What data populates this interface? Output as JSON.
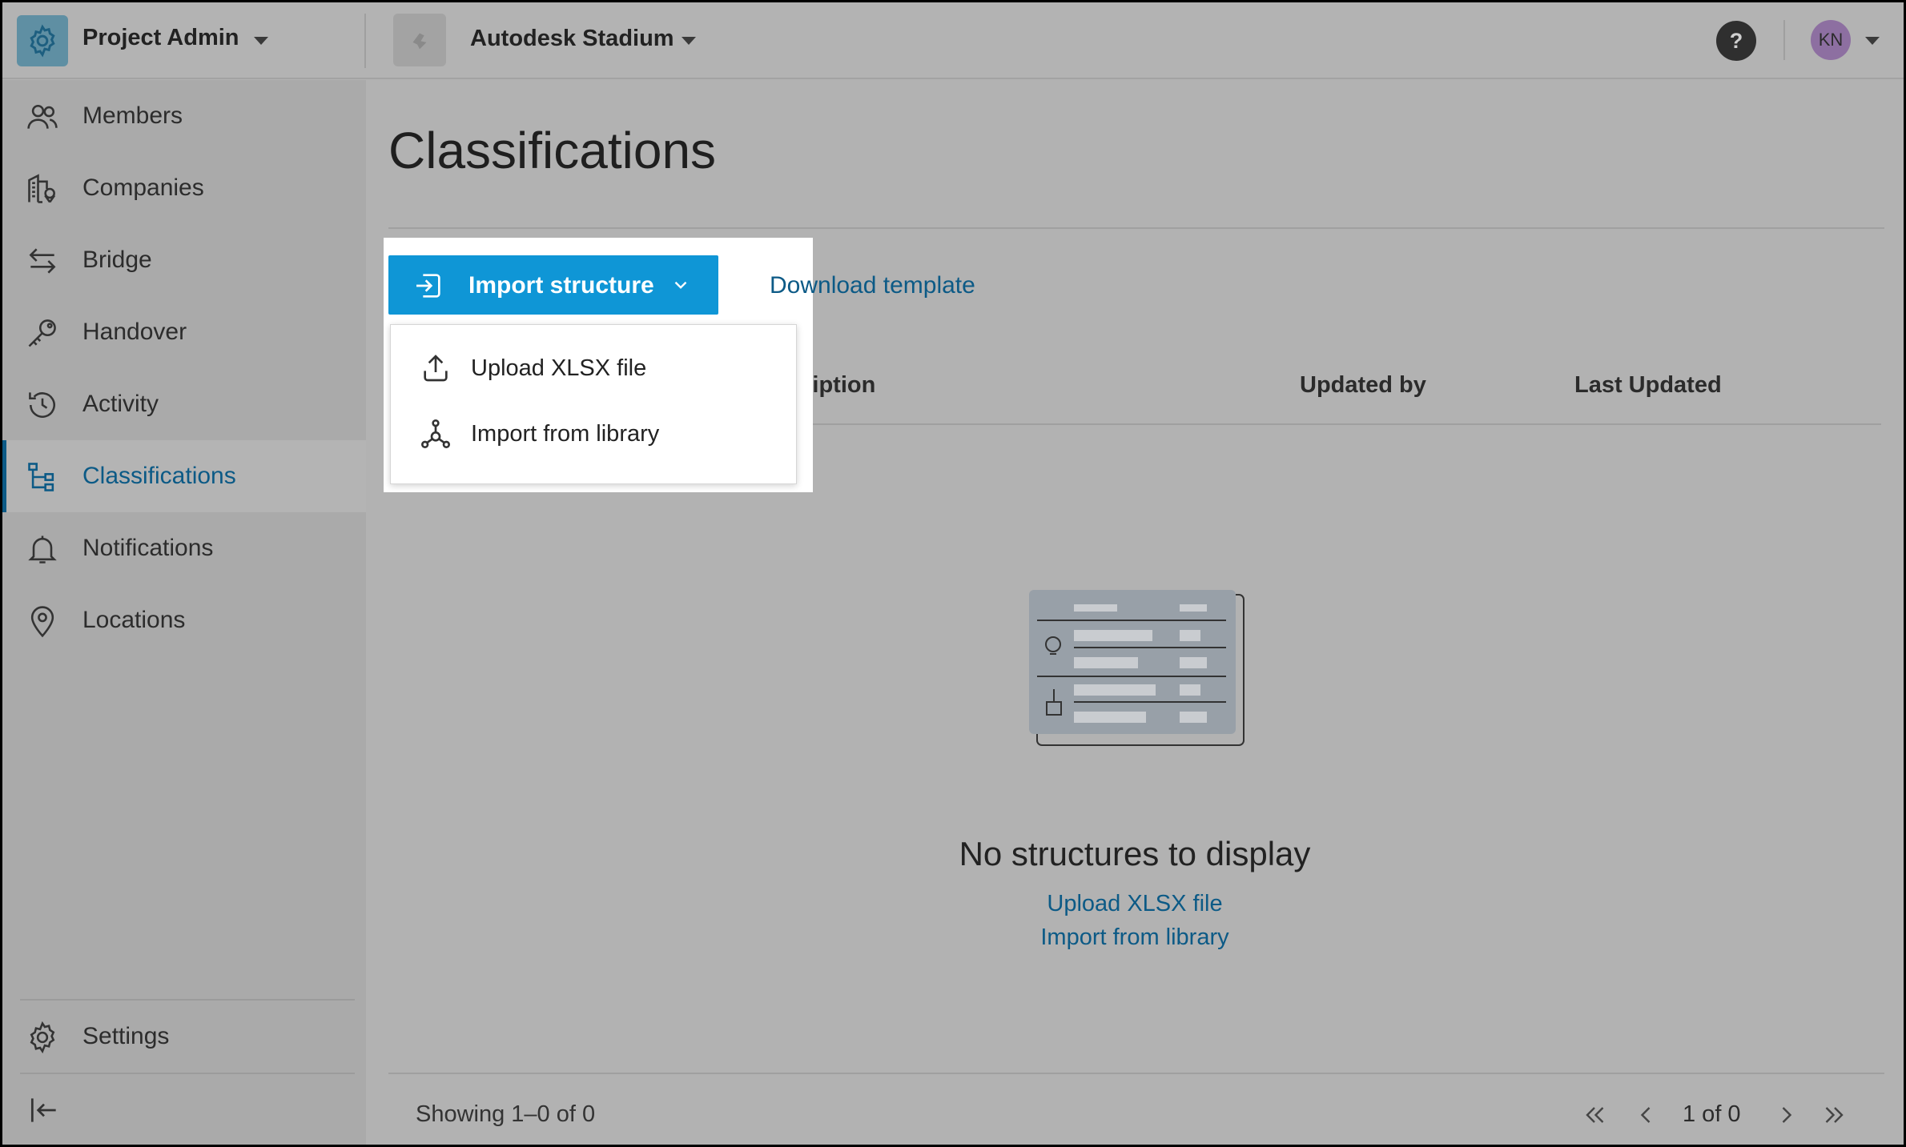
{
  "header": {
    "app_title": "Project Admin",
    "project_name": "Autodesk Stadium",
    "help_label": "?",
    "avatar_initials": "KN"
  },
  "sidebar": {
    "items": [
      {
        "label": "Members",
        "icon": "members-icon"
      },
      {
        "label": "Companies",
        "icon": "companies-icon"
      },
      {
        "label": "Bridge",
        "icon": "bridge-icon"
      },
      {
        "label": "Handover",
        "icon": "key-icon"
      },
      {
        "label": "Activity",
        "icon": "history-icon"
      },
      {
        "label": "Classifications",
        "icon": "hierarchy-icon",
        "active": true
      },
      {
        "label": "Notifications",
        "icon": "bell-icon"
      },
      {
        "label": "Locations",
        "icon": "location-pin-icon"
      }
    ],
    "settings_label": "Settings",
    "collapse_icon": "collapse-sidebar-icon"
  },
  "main": {
    "page_title": "Classifications",
    "import_button_label": "Import structure",
    "download_template_label": "Download template",
    "dropdown_menu": [
      {
        "label": "Upload XLSX file",
        "icon": "upload-icon"
      },
      {
        "label": "Import from library",
        "icon": "library-network-icon"
      }
    ],
    "table_headers": [
      "cription",
      "Updated by",
      "Last Updated"
    ],
    "empty_state": {
      "title": "No structures to display",
      "upload_link": "Upload XLSX file",
      "import_link": "Import from library"
    },
    "footer": {
      "showing_text": "Showing 1–0 of 0",
      "page_status": "1 of 0"
    }
  },
  "colors": {
    "accent": "#0f96d6",
    "link": "#0c5a86",
    "overlay_bg": "#b2b2b2"
  }
}
